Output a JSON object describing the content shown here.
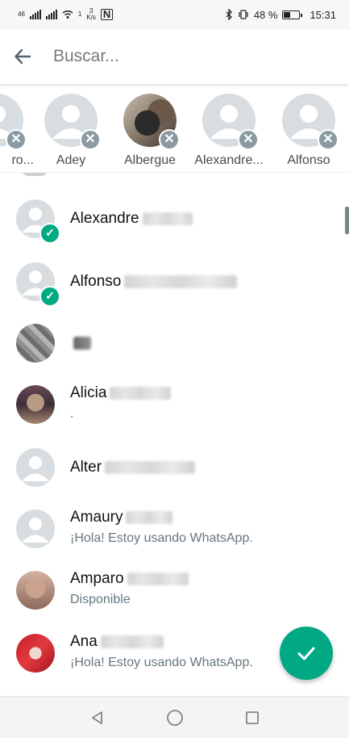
{
  "status_bar": {
    "net_small": "46",
    "data_up": "1",
    "speed_value": "3",
    "speed_unit": "K/s",
    "nfc": "N",
    "battery_pct": "48 %",
    "time": "15:31"
  },
  "search": {
    "placeholder": "Buscar..."
  },
  "selected": [
    {
      "name": "ro...",
      "photo": "default",
      "partial": true
    },
    {
      "name": "Adey",
      "photo": "default"
    },
    {
      "name": "Albergue",
      "photo": "photo-albergue"
    },
    {
      "name": "Alexandre...",
      "photo": "default"
    },
    {
      "name": "Alfonso",
      "photo": "default"
    }
  ],
  "contacts": [
    {
      "name": "Alexandre",
      "blur_surname": true,
      "status": "",
      "selected": true,
      "photo": "default"
    },
    {
      "name": "Alfonso",
      "blur_surname": true,
      "status": "",
      "selected": true,
      "photo": "default"
    },
    {
      "name": "",
      "blur_surname": true,
      "status": "",
      "selected": false,
      "photo": "p-gray"
    },
    {
      "name": "Alicia",
      "blur_surname": true,
      "status": ".",
      "selected": false,
      "photo": "p-face1"
    },
    {
      "name": "Alter",
      "blur_surname": true,
      "status": "",
      "selected": false,
      "photo": "default"
    },
    {
      "name": "Amaury",
      "blur_surname": true,
      "status": "¡Hola! Estoy usando WhatsApp.",
      "selected": false,
      "photo": "default"
    },
    {
      "name": "Amparo",
      "blur_surname": true,
      "status": "Disponible",
      "selected": false,
      "photo": "p-face2"
    },
    {
      "name": "Ana",
      "blur_surname": true,
      "status": "¡Hola! Estoy usando WhatsApp.",
      "selected": false,
      "photo": "p-red"
    }
  ],
  "colors": {
    "accent": "#00a884",
    "badge_gray": "#8b9aa2",
    "secondary_text": "#667781"
  },
  "icons": {
    "back": "arrow-left-icon",
    "remove": "close-icon",
    "selected": "check-icon",
    "fab": "check-icon",
    "nav_back": "triangle-back-icon",
    "nav_home": "circle-home-icon",
    "nav_recents": "square-recents-icon"
  }
}
